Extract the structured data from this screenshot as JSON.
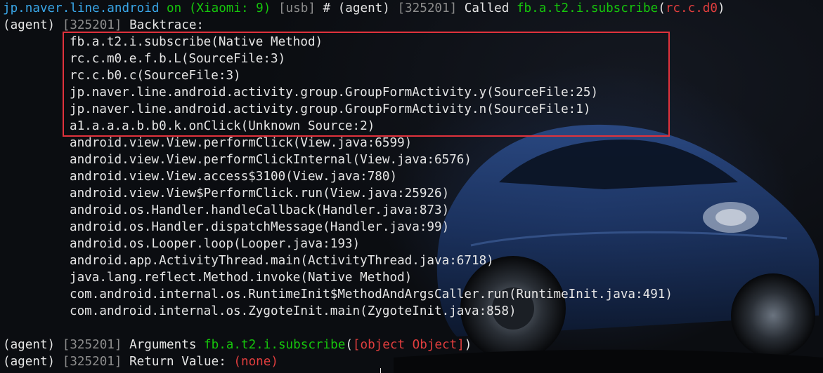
{
  "header": {
    "package": "jp.naver.line.android",
    "on": "on",
    "device": "(Xiaomi: 9)",
    "transport": "[usb]",
    "hash": "#",
    "agent": "(agent)",
    "pid": "[325201]",
    "called": "Called",
    "method_prefix": "fb.a.t2.i.",
    "method_name": "subscribe",
    "paren_open": "(",
    "arg": "rc.c.d0",
    "paren_close": ")"
  },
  "backtrace_label": "Backtrace:",
  "highlighted_frames": [
    "fb.a.t2.i.subscribe(Native Method)",
    "rc.c.m0.e.f.b.L(SourceFile:3)",
    "rc.c.b0.c(SourceFile:3)",
    "jp.naver.line.android.activity.group.GroupFormActivity.y(SourceFile:25)",
    "jp.naver.line.android.activity.group.GroupFormActivity.n(SourceFile:1)",
    "a1.a.a.a.b.b0.k.onClick(Unknown Source:2)"
  ],
  "frames": [
    "android.view.View.performClick(View.java:6599)",
    "android.view.View.performClickInternal(View.java:6576)",
    "android.view.View.access$3100(View.java:780)",
    "android.view.View$PerformClick.run(View.java:25926)",
    "android.os.Handler.handleCallback(Handler.java:873)",
    "android.os.Handler.dispatchMessage(Handler.java:99)",
    "android.os.Looper.loop(Looper.java:193)",
    "android.app.ActivityThread.main(ActivityThread.java:6718)",
    "java.lang.reflect.Method.invoke(Native Method)",
    "com.android.internal.os.RuntimeInit$MethodAndArgsCaller.run(RuntimeInit.java:491)",
    "com.android.internal.os.ZygoteInit.main(ZygoteInit.java:858)"
  ],
  "arguments_line": {
    "agent": "(agent)",
    "pid": "[325201]",
    "label": "Arguments",
    "method_prefix": "fb.a.t2.i.",
    "method_name": "subscribe",
    "paren_open": "(",
    "value": "[object Object]",
    "paren_close": ")"
  },
  "return_line": {
    "agent": "(agent)",
    "pid": "[325201]",
    "label": "Return Value:",
    "value": "(none)"
  },
  "colors": {
    "package": "#39a6e8",
    "method": "#16c60c",
    "arg": "#e23e3e",
    "muted": "#8c8c8c",
    "highlight_box": "#e0323c"
  }
}
